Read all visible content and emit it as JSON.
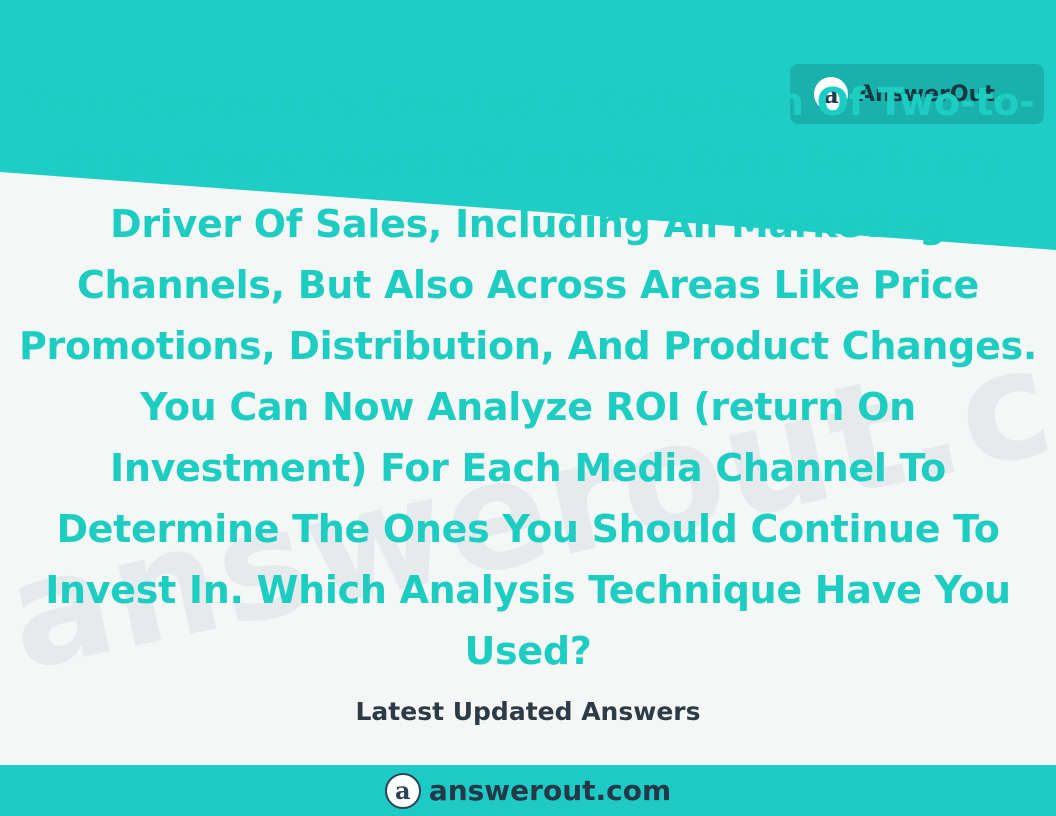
{
  "background": {
    "accent_color": "#1ecdc6",
    "watermark_text": "answerout.com"
  },
  "brand_badge": {
    "icon": "answerout-logo-icon",
    "icon_glyph": "a",
    "label": "AnswerOut"
  },
  "question": {
    "text": "Your Company's Created A Collection Of Two-to-three Years' Worth Of Weekly Data For Every Driver Of Sales, Including All Marketing Channels, But Also Across Areas Like Price Promotions, Distribution, And Product Changes. You Can Now Analyze ROI (return On Investment) For Each Media Channel To Determine The Ones You Should Continue To Invest In. Which Analysis Technique Have You Used?"
  },
  "tagline": "Latest Updated Answers",
  "footer": {
    "icon": "answerout-logo-icon",
    "icon_glyph": "a",
    "domain": "answerout.com"
  }
}
